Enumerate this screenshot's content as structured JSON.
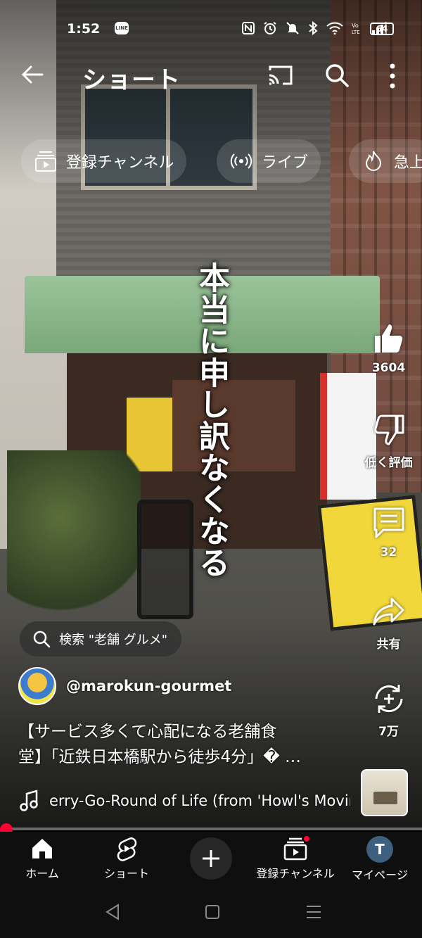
{
  "status_bar": {
    "time": "1:52",
    "line_badge": "LINE",
    "battery": "64",
    "icons": [
      "nfc-icon",
      "alarm-icon",
      "mute-icon",
      "bluetooth-icon",
      "wifi-icon",
      "volte-icon",
      "signal-icon"
    ]
  },
  "app_bar": {
    "title": "ショート"
  },
  "chips": [
    {
      "label": "登録チャンネル",
      "icon": "subscriptions-icon"
    },
    {
      "label": "ライブ",
      "icon": "live-icon"
    },
    {
      "label": "急上",
      "icon": "trending-icon"
    }
  ],
  "video": {
    "overlay_text": "本当に申し訳なくなる"
  },
  "actions": {
    "like_count": "3604",
    "dislike_label": "低く評価",
    "comment_count": "32",
    "share_label": "共有",
    "remix_count": "7万"
  },
  "search_suggestion": {
    "label": "検索 \"老舗 グルメ\""
  },
  "channel": {
    "handle": "@marokun-gourmet"
  },
  "caption": {
    "line1": "【サービス多くて心配になる老舗食",
    "line2": "堂】「近鉄日本橋駅から徒歩4分」� …"
  },
  "music": {
    "title": "erry-Go-Round of Life (from 'Howl's Movin"
  },
  "progress": {
    "fraction": 0.015
  },
  "bottom_nav": {
    "home": "ホーム",
    "shorts": "ショート",
    "subscriptions": "登録チャンネル",
    "mypage": "マイページ",
    "avatar_letter": "T"
  },
  "colors": {
    "accent_red": "#ff0033",
    "nav_bg": "#0f0f0f"
  }
}
